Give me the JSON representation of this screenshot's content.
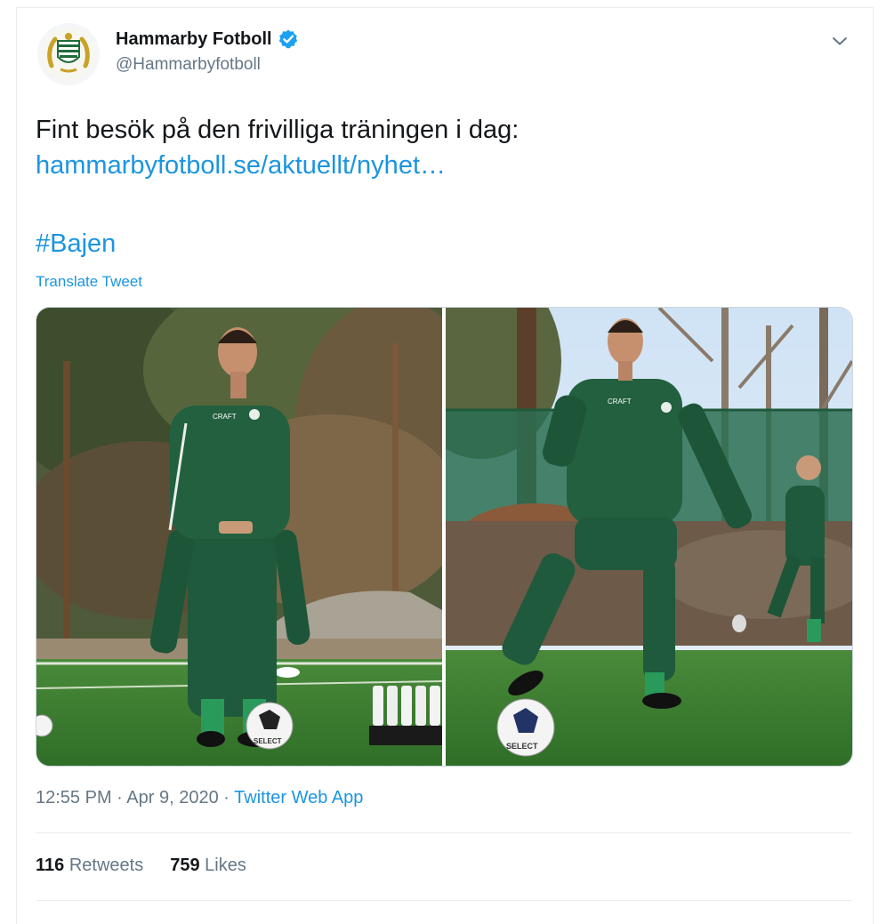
{
  "author": {
    "name": "Hammarby Fotboll",
    "handle": "@Hammarbyfotboll",
    "verified": true,
    "verified_color": "#1da1f2"
  },
  "tweet": {
    "text_line1": "Fint besök på den frivilliga träningen i dag:",
    "link": "hammarbyfotboll.se/aktuellt/nyhet…",
    "hashtag": "#Bajen",
    "translate_label": "Translate Tweet"
  },
  "media": {
    "photo_count": 2,
    "ball_brand": "SELECT",
    "shirt_brand": "CRAFT"
  },
  "meta": {
    "time": "12:55 PM",
    "date": "Apr 9, 2020",
    "separator": "·",
    "app": "Twitter Web App"
  },
  "stats": {
    "retweets_count": "116",
    "retweets_label": "Retweets",
    "likes_count": "759",
    "likes_label": "Likes"
  },
  "colors": {
    "link": "#1b95e0",
    "text": "#14171a",
    "secondary": "#657786",
    "kit_green": "#1f5a3c"
  }
}
